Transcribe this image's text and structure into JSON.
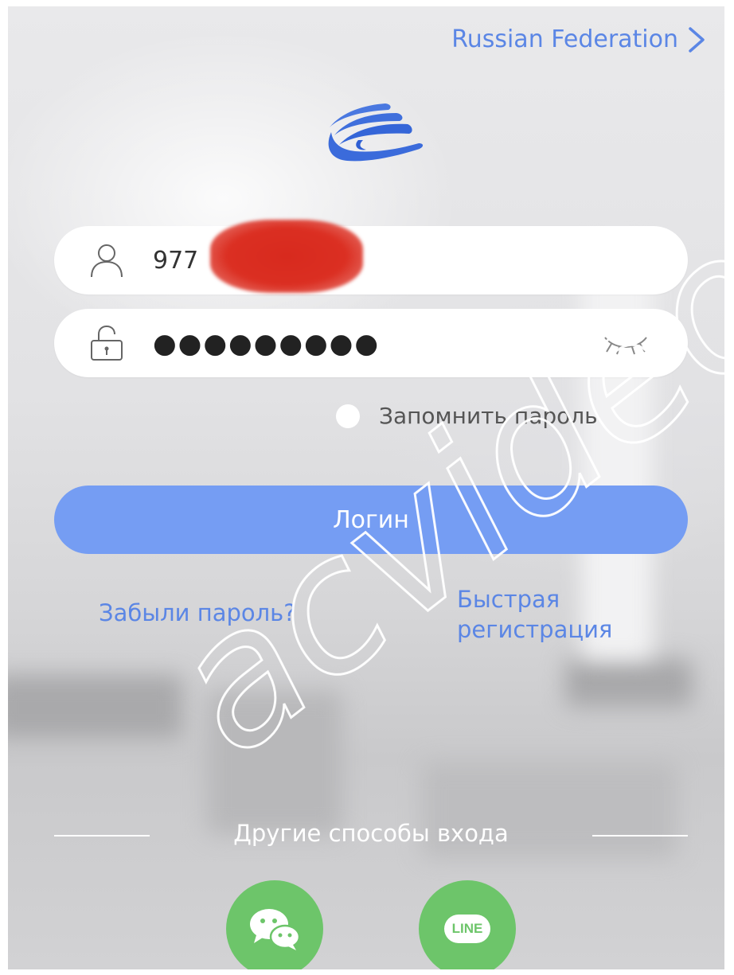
{
  "header": {
    "region_label": "Russian Federation"
  },
  "login_form": {
    "username_value": "977",
    "password_mask": "●●●●●●●●●",
    "remember_label": "Запомнить пароль",
    "login_button_label": "Логин",
    "forgot_password_label": "Забыли пароль?",
    "quick_registration_line1": "Быстрая",
    "quick_registration_line2": "регистрация"
  },
  "other_login": {
    "label": "Другие способы входа",
    "methods": [
      {
        "name": "wechat",
        "icon": "wechat-icon"
      },
      {
        "name": "line",
        "icon": "line-icon",
        "badge_text": "LINE"
      }
    ]
  },
  "watermark_text": "acvideo.ru",
  "colors": {
    "accent_blue": "#5b86e5",
    "login_button": "#759df3",
    "social_green": "#6dc56a"
  }
}
